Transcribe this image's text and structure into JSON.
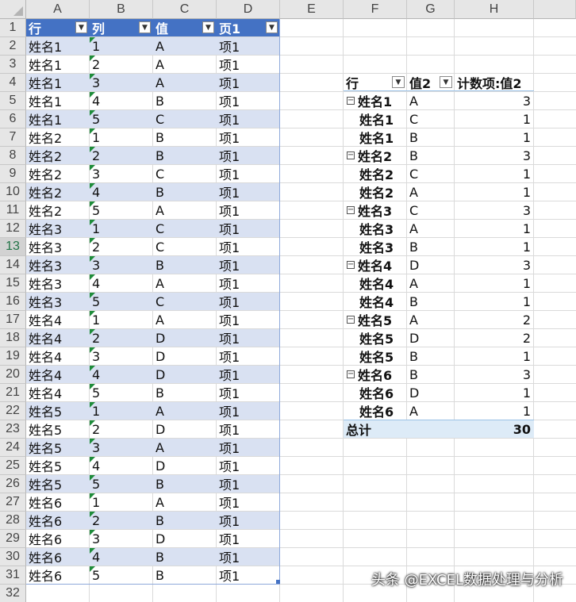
{
  "columns": [
    "A",
    "B",
    "C",
    "D",
    "E",
    "F",
    "G",
    "H"
  ],
  "rows": [
    "1",
    "2",
    "3",
    "4",
    "5",
    "6",
    "7",
    "8",
    "9",
    "10",
    "11",
    "12",
    "13",
    "14",
    "15",
    "16",
    "17",
    "18",
    "19",
    "20",
    "21",
    "22",
    "23",
    "24",
    "25",
    "26",
    "27",
    "28",
    "29",
    "30",
    "31",
    "32"
  ],
  "table": {
    "headers": [
      "行",
      "列",
      "值",
      "页1"
    ],
    "rows": [
      [
        "姓名1",
        "1",
        "A",
        "项1"
      ],
      [
        "姓名1",
        "2",
        "A",
        "项1"
      ],
      [
        "姓名1",
        "3",
        "A",
        "项1"
      ],
      [
        "姓名1",
        "4",
        "B",
        "项1"
      ],
      [
        "姓名1",
        "5",
        "C",
        "项1"
      ],
      [
        "姓名2",
        "1",
        "B",
        "项1"
      ],
      [
        "姓名2",
        "2",
        "B",
        "项1"
      ],
      [
        "姓名2",
        "3",
        "C",
        "项1"
      ],
      [
        "姓名2",
        "4",
        "B",
        "项1"
      ],
      [
        "姓名2",
        "5",
        "A",
        "项1"
      ],
      [
        "姓名3",
        "1",
        "C",
        "项1"
      ],
      [
        "姓名3",
        "2",
        "C",
        "项1"
      ],
      [
        "姓名3",
        "3",
        "B",
        "项1"
      ],
      [
        "姓名3",
        "4",
        "A",
        "项1"
      ],
      [
        "姓名3",
        "5",
        "C",
        "项1"
      ],
      [
        "姓名4",
        "1",
        "A",
        "项1"
      ],
      [
        "姓名4",
        "2",
        "D",
        "项1"
      ],
      [
        "姓名4",
        "3",
        "D",
        "项1"
      ],
      [
        "姓名4",
        "4",
        "D",
        "项1"
      ],
      [
        "姓名4",
        "5",
        "B",
        "项1"
      ],
      [
        "姓名5",
        "1",
        "A",
        "项1"
      ],
      [
        "姓名5",
        "2",
        "D",
        "项1"
      ],
      [
        "姓名5",
        "3",
        "A",
        "项1"
      ],
      [
        "姓名5",
        "4",
        "D",
        "项1"
      ],
      [
        "姓名5",
        "5",
        "B",
        "项1"
      ],
      [
        "姓名6",
        "1",
        "A",
        "项1"
      ],
      [
        "姓名6",
        "2",
        "B",
        "项1"
      ],
      [
        "姓名6",
        "3",
        "D",
        "项1"
      ],
      [
        "姓名6",
        "4",
        "B",
        "项1"
      ],
      [
        "姓名6",
        "5",
        "B",
        "项1"
      ]
    ]
  },
  "pivot": {
    "headers": [
      "行",
      "值2",
      "计数项:值2"
    ],
    "rows": [
      {
        "name": "姓名1",
        "val": "A",
        "count": "3",
        "group": true
      },
      {
        "name": "姓名1",
        "val": "C",
        "count": "1",
        "group": false
      },
      {
        "name": "姓名1",
        "val": "B",
        "count": "1",
        "group": false
      },
      {
        "name": "姓名2",
        "val": "B",
        "count": "3",
        "group": true
      },
      {
        "name": "姓名2",
        "val": "C",
        "count": "1",
        "group": false
      },
      {
        "name": "姓名2",
        "val": "A",
        "count": "1",
        "group": false
      },
      {
        "name": "姓名3",
        "val": "C",
        "count": "3",
        "group": true
      },
      {
        "name": "姓名3",
        "val": "A",
        "count": "1",
        "group": false
      },
      {
        "name": "姓名3",
        "val": "B",
        "count": "1",
        "group": false
      },
      {
        "name": "姓名4",
        "val": "D",
        "count": "3",
        "group": true
      },
      {
        "name": "姓名4",
        "val": "A",
        "count": "1",
        "group": false
      },
      {
        "name": "姓名4",
        "val": "B",
        "count": "1",
        "group": false
      },
      {
        "name": "姓名5",
        "val": "A",
        "count": "2",
        "group": true
      },
      {
        "name": "姓名5",
        "val": "D",
        "count": "2",
        "group": false
      },
      {
        "name": "姓名5",
        "val": "B",
        "count": "1",
        "group": false
      },
      {
        "name": "姓名6",
        "val": "B",
        "count": "3",
        "group": true
      },
      {
        "name": "姓名6",
        "val": "D",
        "count": "1",
        "group": false
      },
      {
        "name": "姓名6",
        "val": "A",
        "count": "1",
        "group": false
      }
    ],
    "total_label": "总计",
    "total_value": "30"
  },
  "selected_row": "13",
  "watermark": "头条 @EXCEL数据处理与分析",
  "colors": {
    "table_header": "#4472c4",
    "band": "#d9e1f2",
    "pivot_total": "#ddebf7"
  },
  "icons": {
    "filter": "filter-dropdown-icon",
    "sort": "sort-dropdown-icon",
    "collapse": "collapse-minus-icon",
    "number_as_text": "green-error-triangle-icon"
  }
}
